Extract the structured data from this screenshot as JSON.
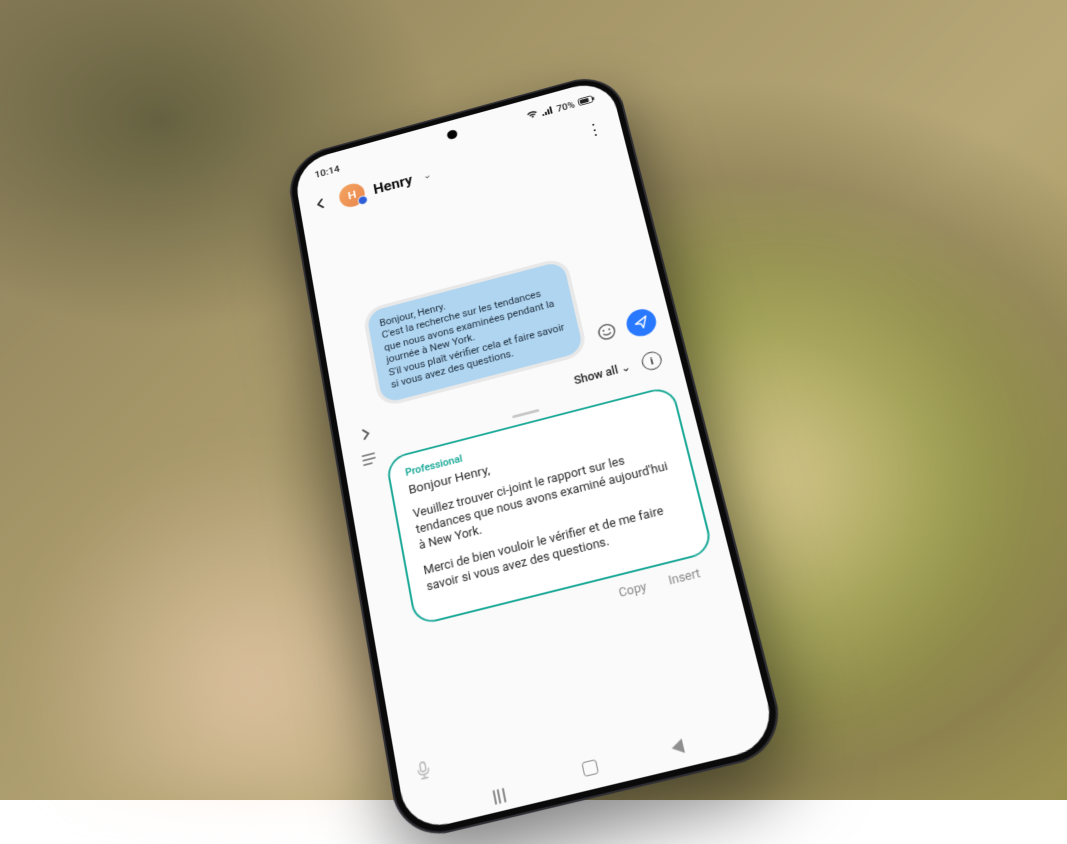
{
  "status": {
    "time": "10:14",
    "battery": "70%",
    "icons": {
      "wifi": "wifi-icon",
      "signal": "signal-icon",
      "battery": "battery-icon"
    }
  },
  "header": {
    "contact_name": "Henry",
    "avatar_initial": "H"
  },
  "message": {
    "text": "Bonjour, Henry.\nC'est la recherche sur les tendances que nous avons examinées pendant la journée à New York.\nS'il vous plaît vérifier cela et faire savoir si vous avez des questions."
  },
  "showall": {
    "label": "Show all"
  },
  "suggestion": {
    "label": "Professional",
    "greeting": "Bonjour Henry,",
    "para1": "Veuillez trouver ci-joint le rapport sur les tendances que nous avons examiné aujourd'hui à New York.",
    "para2": "Merci de bien vouloir le vérifier et de me faire savoir si vous avez des questions."
  },
  "actions": {
    "copy": "Copy",
    "insert": "Insert"
  }
}
